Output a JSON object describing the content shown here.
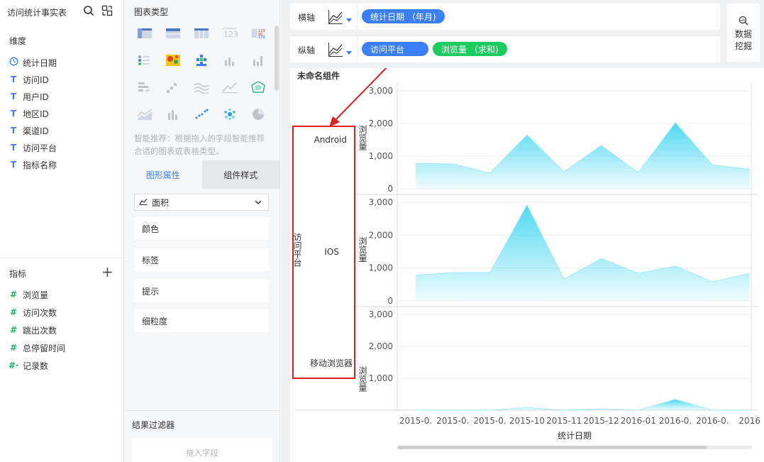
{
  "left": {
    "title": "访问统计事实表",
    "dimension_section": "维度",
    "dimensions": [
      {
        "type": "date",
        "icon": "clock-icon",
        "label": "统计日期"
      },
      {
        "type": "text",
        "icon": "T",
        "label": "访问ID"
      },
      {
        "type": "text",
        "icon": "T",
        "label": "用户ID"
      },
      {
        "type": "text",
        "icon": "T",
        "label": "地区ID"
      },
      {
        "type": "text",
        "icon": "T",
        "label": "渠道ID"
      },
      {
        "type": "text",
        "icon": "T",
        "label": "访问平台"
      },
      {
        "type": "text",
        "icon": "T",
        "label": "指标名称"
      }
    ],
    "measure_section": "指标",
    "add_glyph": "+",
    "measures": [
      {
        "icon": "#",
        "label": "浏览量"
      },
      {
        "icon": "#",
        "label": "访问次数"
      },
      {
        "icon": "#",
        "label": "跳出次数"
      },
      {
        "icon": "#",
        "label": "总停留时间"
      },
      {
        "icon": "#·",
        "label": "记录数"
      }
    ]
  },
  "middle": {
    "chart_types_title": "图表类型",
    "smart_hint": "智能推荐：根据拖入的字段智能推荐合适的图表或表格类型。",
    "tabs": [
      "图形属性",
      "组件样式"
    ],
    "active_tab": 0,
    "chart_style_select": "面积",
    "properties": [
      "颜色",
      "标签",
      "提示",
      "细粒度"
    ],
    "filter_title": "结果过滤器",
    "drop_placeholder": "拖入字段"
  },
  "axes": {
    "x_axis_label": "横轴",
    "y_axis_label": "纵轴",
    "x_fields": [
      {
        "label": "统计日期 （年月)",
        "color": "#3a7ff5"
      }
    ],
    "y_fields": [
      {
        "label": "访问平台",
        "color": "#3a7ff5"
      },
      {
        "label": "浏览量 （求和)",
        "color": "#1ccc5f"
      }
    ]
  },
  "mining_button": {
    "line1": "数据",
    "line2": "挖掘"
  },
  "chart": {
    "component_title": "未命名组件",
    "annotation_color": "#e02020"
  },
  "chart_data": {
    "type": "area",
    "title": "",
    "facet_label": "访问平台",
    "xlabel": "统计日期",
    "ylabel": "浏览量",
    "x_tick_labels": [
      "2015-0.",
      "2015-0.",
      "2015-0.",
      "2015-10",
      "2015-11",
      "2015-12",
      "2016-01",
      "2016-0.",
      "2016-0.",
      "2016"
    ],
    "ylim": [
      0,
      3000
    ],
    "y_ticks": [
      "0",
      "1,000",
      "2,000",
      "3,000"
    ],
    "fill_color": "#4fd8f2",
    "series": [
      {
        "name": "Android",
        "values": [
          780,
          760,
          480,
          1650,
          520,
          1330,
          500,
          2030,
          730,
          600
        ]
      },
      {
        "name": "IOS",
        "values": [
          780,
          860,
          860,
          2920,
          660,
          1290,
          840,
          1060,
          580,
          840
        ]
      },
      {
        "name": "移动浏览器",
        "values": [
          0,
          0,
          0,
          80,
          0,
          40,
          0,
          340,
          0,
          0
        ]
      }
    ]
  }
}
